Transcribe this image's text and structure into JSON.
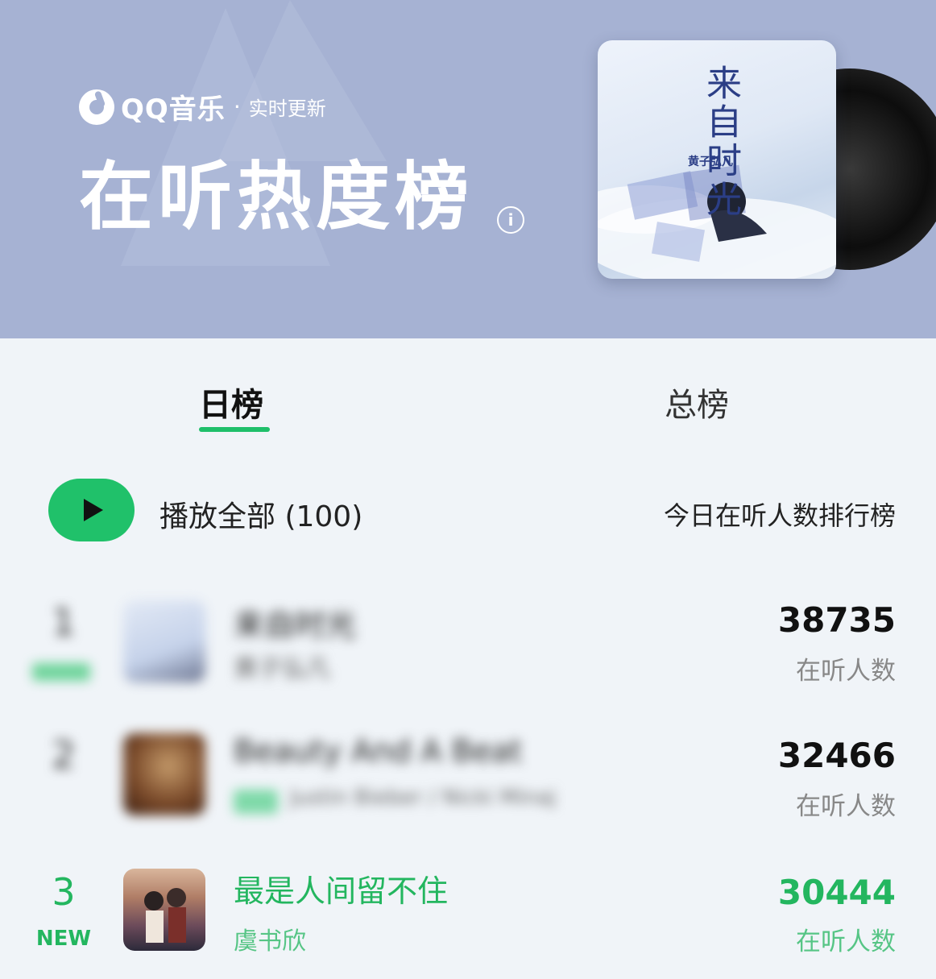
{
  "header": {
    "brand_name": "QQ音乐",
    "brand_separator": "·",
    "brand_subtitle": "实时更新",
    "title": "在听热度榜",
    "info_icon_glyph": "i",
    "background_color": "#a6b2d3",
    "cover": {
      "title_text": "来自时光",
      "artist_text": "黄子弘凡"
    }
  },
  "tabs": [
    {
      "label": "日榜",
      "active": true
    },
    {
      "label": "总榜",
      "active": false
    }
  ],
  "play_all": {
    "label": "播放全部 (100)",
    "accent_color": "#20c16a"
  },
  "ranking_description": "今日在听人数排行榜",
  "songs": [
    {
      "rank": "1",
      "title": "来自时光",
      "artist": "黄子弘凡",
      "count": "38735",
      "count_label": "在听人数",
      "blurred": true
    },
    {
      "rank": "2",
      "title": "Beauty And A Beat",
      "artist": "Justin Bieber / Nicki Minaj",
      "count": "32466",
      "count_label": "在听人数",
      "blurred": true
    },
    {
      "rank": "3",
      "badge": "NEW",
      "title": "最是人间留不住",
      "artist": "虞书欣",
      "count": "30444",
      "count_label": "在听人数",
      "blurred": false,
      "highlight_color": "#23b65f"
    }
  ]
}
